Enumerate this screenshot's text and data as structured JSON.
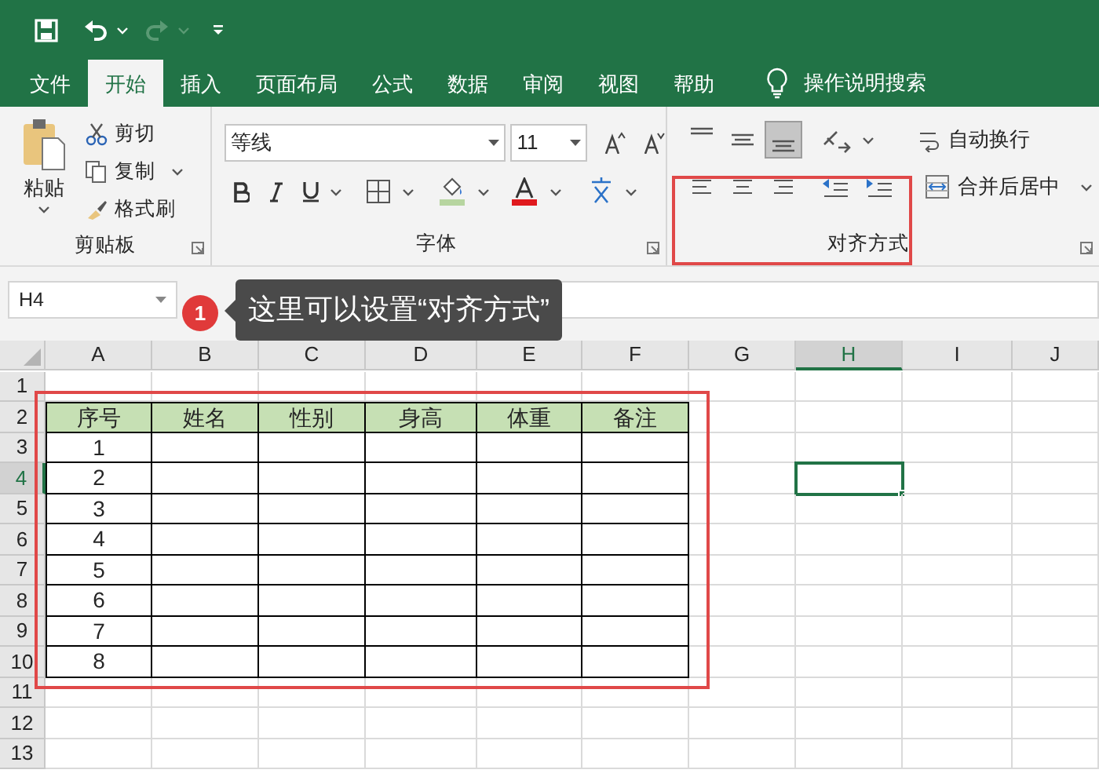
{
  "tabs": [
    {
      "label": "文件",
      "selected": false
    },
    {
      "label": "开始",
      "selected": true
    },
    {
      "label": "插入",
      "selected": false
    },
    {
      "label": "页面布局",
      "selected": false
    },
    {
      "label": "公式",
      "selected": false
    },
    {
      "label": "数据",
      "selected": false
    },
    {
      "label": "审阅",
      "selected": false
    },
    {
      "label": "视图",
      "selected": false
    },
    {
      "label": "帮助",
      "selected": false
    }
  ],
  "tell_me": "操作说明搜索",
  "clipboard": {
    "paste": "粘贴",
    "cut": "剪切",
    "copy": "复制",
    "format_painter": "格式刷",
    "title": "剪贴板"
  },
  "font": {
    "font_name": "等线",
    "font_size": "11",
    "title": "字体"
  },
  "alignment": {
    "vertical": [
      {
        "selected": false
      },
      {
        "selected": false
      },
      {
        "selected": true
      }
    ],
    "horizontal": [
      {
        "selected": false
      },
      {
        "selected": false
      },
      {
        "selected": false
      }
    ],
    "wrap_text": "自动换行",
    "merge_center": "合并后居中",
    "title": "对齐方式"
  },
  "name_box": "H4",
  "callout": {
    "number": "1",
    "text": "这里可以设置“对齐方式”"
  },
  "sheet": {
    "columns": [
      {
        "label": "A",
        "selected": false
      },
      {
        "label": "B",
        "selected": false
      },
      {
        "label": "C",
        "selected": false
      },
      {
        "label": "D",
        "selected": false
      },
      {
        "label": "E",
        "selected": false
      },
      {
        "label": "F",
        "selected": false
      },
      {
        "label": "G",
        "selected": false
      },
      {
        "label": "H",
        "selected": true
      },
      {
        "label": "I",
        "selected": false
      },
      {
        "label": "J",
        "selected": false
      }
    ],
    "rows": [
      {
        "label": "1",
        "selected": false
      },
      {
        "label": "2",
        "selected": false
      },
      {
        "label": "3",
        "selected": false
      },
      {
        "label": "4",
        "selected": true
      },
      {
        "label": "5",
        "selected": false
      },
      {
        "label": "6",
        "selected": false
      },
      {
        "label": "7",
        "selected": false
      },
      {
        "label": "8",
        "selected": false
      },
      {
        "label": "9",
        "selected": false
      },
      {
        "label": "10",
        "selected": false
      },
      {
        "label": "11",
        "selected": false
      },
      {
        "label": "12",
        "selected": false
      },
      {
        "label": "13",
        "selected": false
      }
    ],
    "table": {
      "header": [
        "序号",
        "姓名",
        "性别",
        "身高",
        "体重",
        "备注"
      ],
      "rows": [
        {
          "serial": "1"
        },
        {
          "serial": "2"
        },
        {
          "serial": "3"
        },
        {
          "serial": "4"
        },
        {
          "serial": "5"
        },
        {
          "serial": "6"
        },
        {
          "serial": "7"
        },
        {
          "serial": "8"
        }
      ]
    }
  }
}
